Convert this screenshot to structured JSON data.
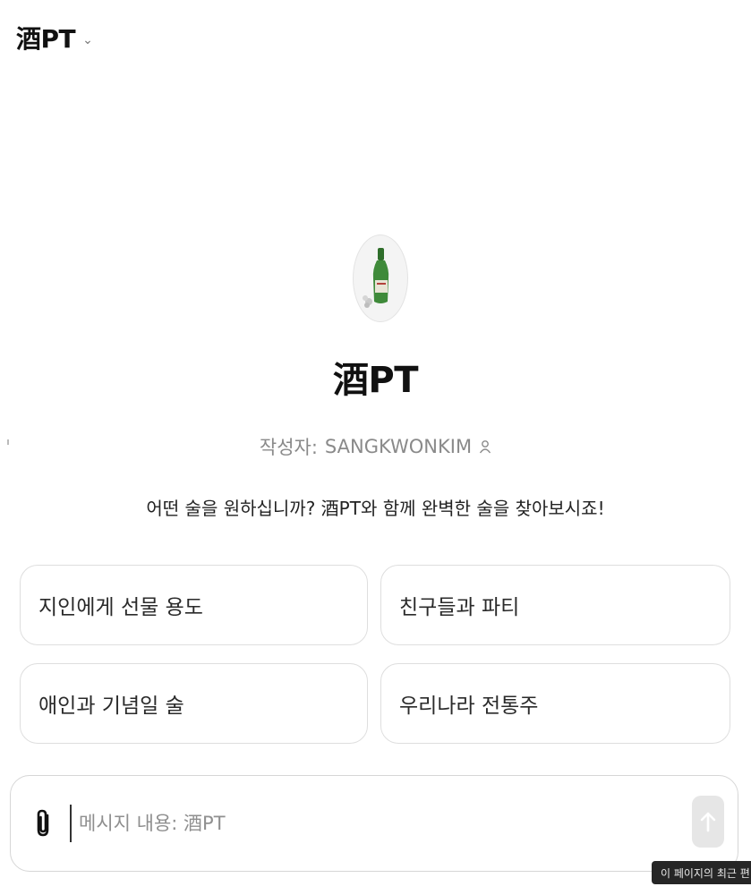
{
  "header": {
    "title": "酒PT",
    "chevron_icon": "chevron-down-icon"
  },
  "gpt": {
    "avatar_icon": "soju-bottle-icon",
    "name": "酒PT",
    "author_prefix": "작성자:",
    "author_name": "SANGKWONKIM",
    "author_icon": "person-icon",
    "description": "어떤 술을 원하십니까? 酒PT와 함께 완벽한 술을 찾아보시죠!"
  },
  "prompts": [
    {
      "label": "지인에게 선물 용도"
    },
    {
      "label": "친구들과 파티"
    },
    {
      "label": "애인과 기념일 술"
    },
    {
      "label": "우리나라 전통주"
    }
  ],
  "composer": {
    "placeholder": "메시지 내용: 酒PT",
    "value": "",
    "attach_icon": "paperclip-icon",
    "send_icon": "arrow-up-icon"
  },
  "toast": {
    "text": "이 페이지의 최근 편"
  },
  "colors": {
    "background": "#ffffff",
    "card_border": "#dedede",
    "muted_text": "#8a8a8a",
    "send_button": "#e6e6e6",
    "bottle_green": "#3f8a3a"
  }
}
